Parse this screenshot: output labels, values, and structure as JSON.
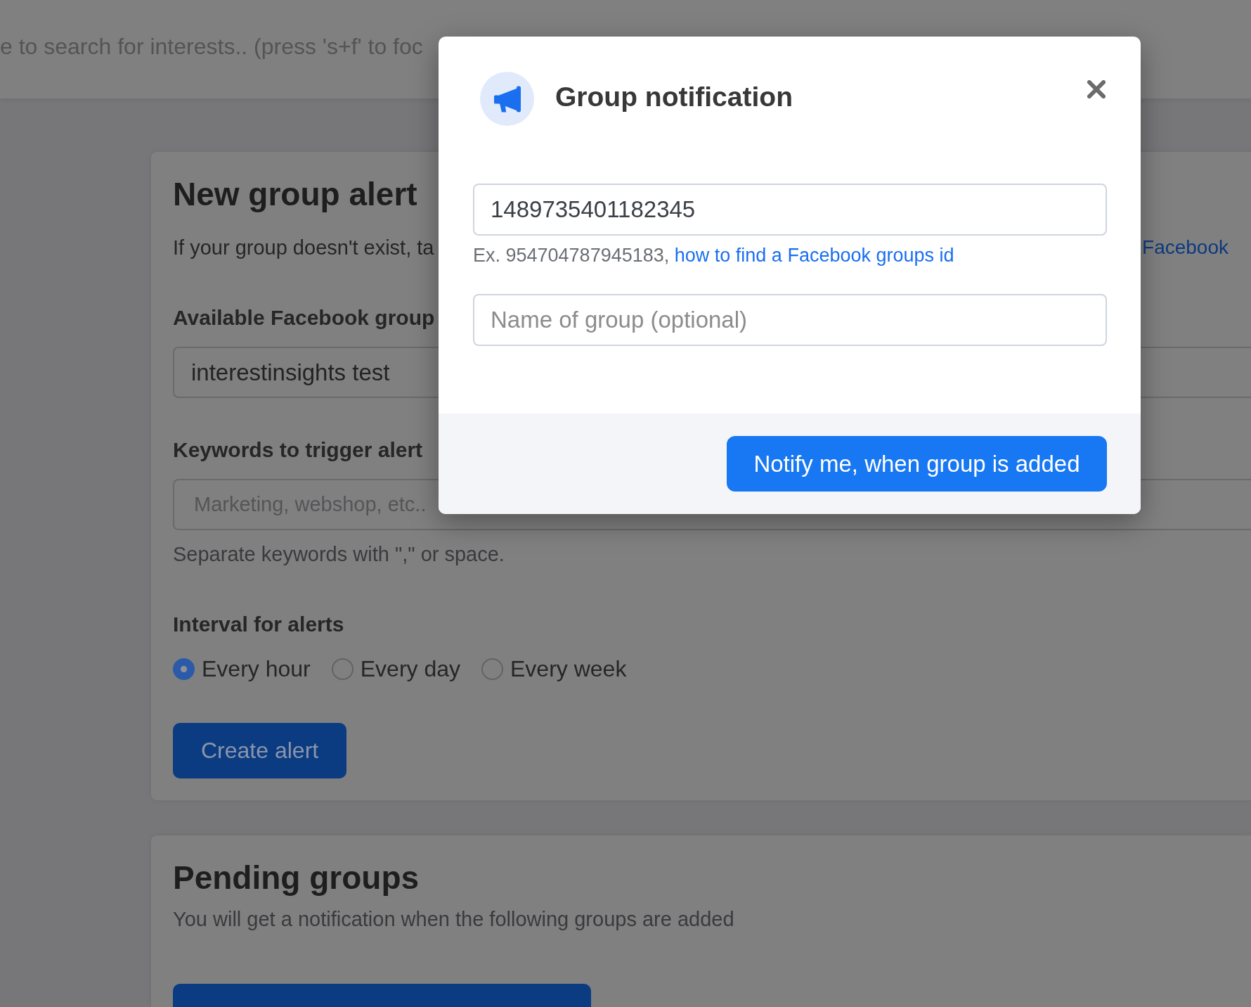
{
  "search": {
    "placeholder": "e to search for interests.. (press 's+f' to foc"
  },
  "alert_card": {
    "title": "New group alert",
    "intro": "If your group doesn't exist, ta",
    "intro_link": "Facebook",
    "fields": [
      {
        "label": "Available Facebook group",
        "value": "interestinsights test"
      },
      {
        "label": "Keywords to trigger alert",
        "placeholder": "Marketing, webshop, etc..",
        "help": "Separate keywords with \",\" or space."
      }
    ],
    "interval": {
      "label": "Interval for alerts",
      "options": [
        {
          "label": "Every hour",
          "selected": true
        },
        {
          "label": "Every day",
          "selected": false
        },
        {
          "label": "Every week",
          "selected": false
        }
      ]
    },
    "submit_button": "Create alert"
  },
  "pending_card": {
    "title": "Pending groups",
    "description": "You will get a notification when the following groups are added",
    "buttons": [
      {
        "kind": "primary"
      }
    ]
  },
  "modal": {
    "title": "Group notification",
    "fields": [
      {
        "value": "1489735401182345",
        "help": "Ex. 954704787945183,",
        "help_link": "how to find a Facebook groups id"
      },
      {
        "placeholder": "Name of group (optional)"
      }
    ],
    "submit_button": "Notify me, when group is added"
  }
}
